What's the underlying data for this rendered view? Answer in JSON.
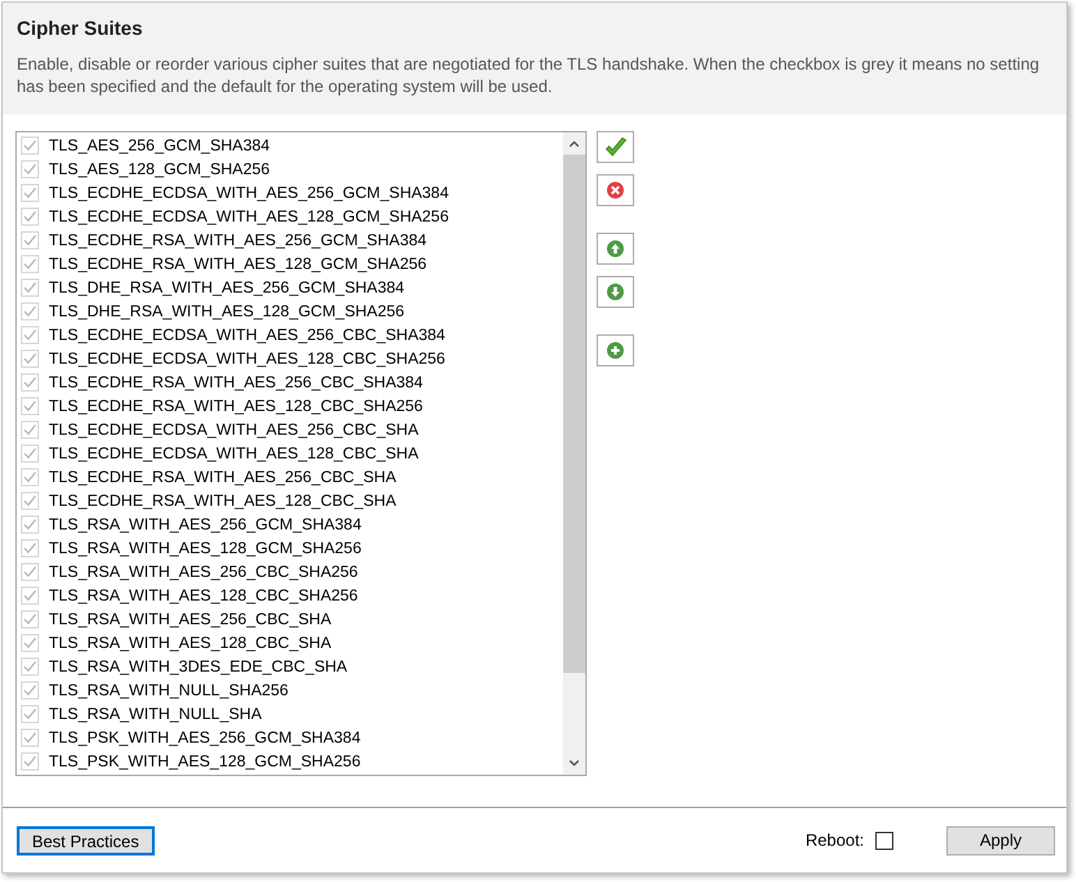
{
  "title": "Cipher Suites",
  "description": "Enable, disable or reorder various cipher suites that are negotiated for the TLS handshake. When the checkbox is grey it means no setting has been specified and the default for the operating system will be used.",
  "suites": [
    {
      "name": "TLS_AES_256_GCM_SHA384",
      "checked": true,
      "greyed": true
    },
    {
      "name": "TLS_AES_128_GCM_SHA256",
      "checked": true,
      "greyed": true
    },
    {
      "name": "TLS_ECDHE_ECDSA_WITH_AES_256_GCM_SHA384",
      "checked": true,
      "greyed": true
    },
    {
      "name": "TLS_ECDHE_ECDSA_WITH_AES_128_GCM_SHA256",
      "checked": true,
      "greyed": true
    },
    {
      "name": "TLS_ECDHE_RSA_WITH_AES_256_GCM_SHA384",
      "checked": true,
      "greyed": true
    },
    {
      "name": "TLS_ECDHE_RSA_WITH_AES_128_GCM_SHA256",
      "checked": true,
      "greyed": true
    },
    {
      "name": "TLS_DHE_RSA_WITH_AES_256_GCM_SHA384",
      "checked": true,
      "greyed": true
    },
    {
      "name": "TLS_DHE_RSA_WITH_AES_128_GCM_SHA256",
      "checked": true,
      "greyed": true
    },
    {
      "name": "TLS_ECDHE_ECDSA_WITH_AES_256_CBC_SHA384",
      "checked": true,
      "greyed": true
    },
    {
      "name": "TLS_ECDHE_ECDSA_WITH_AES_128_CBC_SHA256",
      "checked": true,
      "greyed": true
    },
    {
      "name": "TLS_ECDHE_RSA_WITH_AES_256_CBC_SHA384",
      "checked": true,
      "greyed": true
    },
    {
      "name": "TLS_ECDHE_RSA_WITH_AES_128_CBC_SHA256",
      "checked": true,
      "greyed": true
    },
    {
      "name": "TLS_ECDHE_ECDSA_WITH_AES_256_CBC_SHA",
      "checked": true,
      "greyed": true
    },
    {
      "name": "TLS_ECDHE_ECDSA_WITH_AES_128_CBC_SHA",
      "checked": true,
      "greyed": true
    },
    {
      "name": "TLS_ECDHE_RSA_WITH_AES_256_CBC_SHA",
      "checked": true,
      "greyed": true
    },
    {
      "name": "TLS_ECDHE_RSA_WITH_AES_128_CBC_SHA",
      "checked": true,
      "greyed": true
    },
    {
      "name": "TLS_RSA_WITH_AES_256_GCM_SHA384",
      "checked": true,
      "greyed": true
    },
    {
      "name": "TLS_RSA_WITH_AES_128_GCM_SHA256",
      "checked": true,
      "greyed": true
    },
    {
      "name": "TLS_RSA_WITH_AES_256_CBC_SHA256",
      "checked": true,
      "greyed": true
    },
    {
      "name": "TLS_RSA_WITH_AES_128_CBC_SHA256",
      "checked": true,
      "greyed": true
    },
    {
      "name": "TLS_RSA_WITH_AES_256_CBC_SHA",
      "checked": true,
      "greyed": true
    },
    {
      "name": "TLS_RSA_WITH_AES_128_CBC_SHA",
      "checked": true,
      "greyed": true
    },
    {
      "name": "TLS_RSA_WITH_3DES_EDE_CBC_SHA",
      "checked": true,
      "greyed": true
    },
    {
      "name": "TLS_RSA_WITH_NULL_SHA256",
      "checked": true,
      "greyed": true
    },
    {
      "name": "TLS_RSA_WITH_NULL_SHA",
      "checked": true,
      "greyed": true
    },
    {
      "name": "TLS_PSK_WITH_AES_256_GCM_SHA384",
      "checked": true,
      "greyed": true
    },
    {
      "name": "TLS_PSK_WITH_AES_128_GCM_SHA256",
      "checked": true,
      "greyed": true
    }
  ],
  "tools": [
    {
      "kind": "enable"
    },
    {
      "kind": "disable"
    },
    {
      "kind": "up"
    },
    {
      "kind": "down"
    },
    {
      "kind": "add"
    }
  ],
  "best_practices_button": "Best Practices",
  "reboot": {
    "label": "Reboot:",
    "checked": false
  },
  "apply_button": "Apply"
}
